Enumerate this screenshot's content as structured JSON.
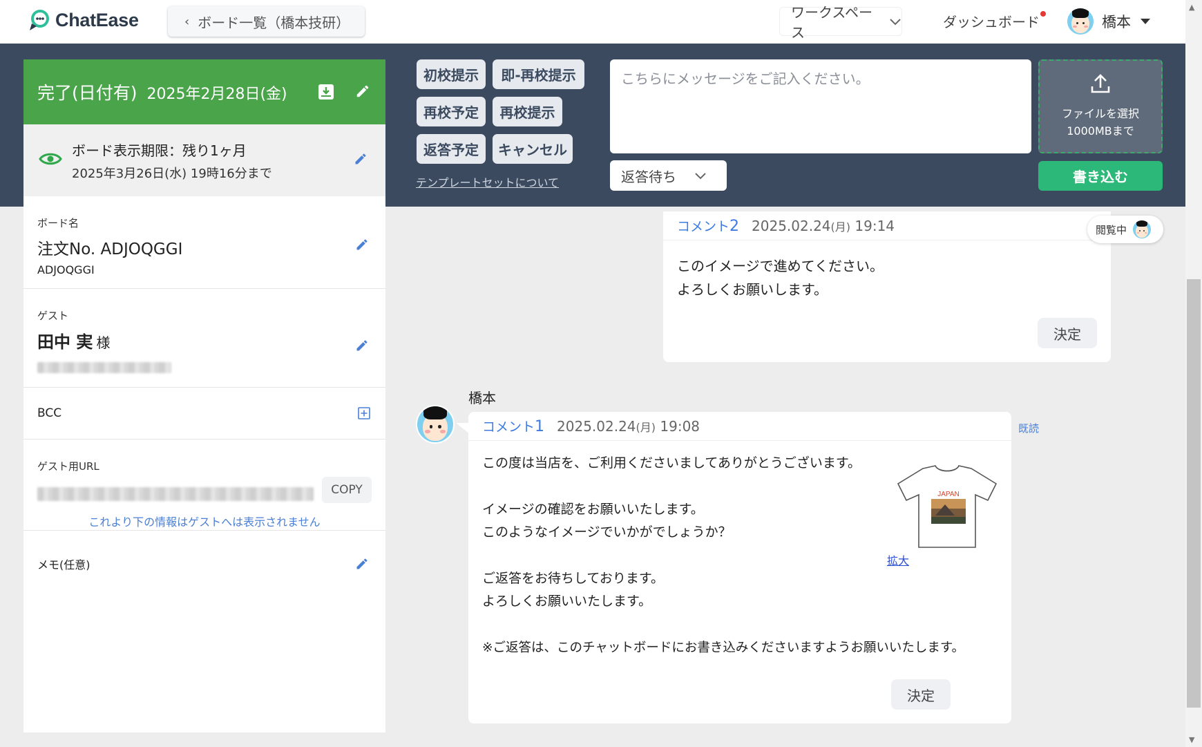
{
  "app": {
    "name": "ChatEase"
  },
  "header": {
    "back_label": "ボード一覧（橋本技研）",
    "workspace_label": "ワークスペース",
    "dashboard_label": "ダッシュボード",
    "user_name": "橋本"
  },
  "status": {
    "title": "完了(日付有)",
    "date": "2025年2月28日(金)"
  },
  "deadline": {
    "line1": "ボード表示期限：残り1ヶ月",
    "line2": "2025年3月26日(水) 19時16分まで"
  },
  "board": {
    "label": "ボード名",
    "title": "注文No. ADJOQGGI",
    "code": "ADJOQGGI"
  },
  "guest": {
    "label": "ゲスト",
    "name": "田中 実",
    "suffix": "様"
  },
  "bcc": {
    "label": "BCC"
  },
  "guest_url": {
    "label": "ゲスト用URL",
    "copy_label": "COPY"
  },
  "notice": "これより下の情報はゲストへは表示されません",
  "memo": {
    "label": "メモ(任意)"
  },
  "templates": {
    "buttons": [
      "初校提示",
      "即-再校提示",
      "再校予定",
      "再校提示",
      "返答予定",
      "キャンセル"
    ],
    "link": "テンプレートセットについて"
  },
  "composer": {
    "placeholder": "こちらにメッセージをご記入ください。",
    "status_value": "返答待ち",
    "file_line1": "ファイルを選択",
    "file_line2": "1000MBまで",
    "submit_label": "書き込む"
  },
  "viewing_label": "閲覧中",
  "comments": [
    {
      "label": "コメント",
      "number": "2",
      "datetime": "2025.02.24",
      "weekday": "(月)",
      "time": "19:14",
      "lines": [
        "このイメージで進めてください。",
        "よろしくお願いします。"
      ],
      "decide_label": "決定"
    },
    {
      "author": "橋本",
      "label": "コメント",
      "number": "1",
      "datetime": "2025.02.24",
      "weekday": "(月)",
      "time": "19:08",
      "read_label": "既読",
      "lines": [
        "この度は当店を、ご利用くださいましてありがとうございます。",
        "",
        "イメージの確認をお願いいたします。",
        "このようなイメージでいかがでしょうか？",
        "",
        "ご返答をお待ちしております。",
        "よろしくお願いいたします。",
        "",
        "※ご返答は、このチャットボードにお書き込みくださいますようお願いいたします。"
      ],
      "thumb_text": "JAPAN",
      "zoom_label": "拡大",
      "decide_label": "決定"
    }
  ],
  "colors": {
    "band": "#3b4a5f",
    "status_green": "#4aa44a",
    "submit_green": "#2cb878",
    "link_blue": "#3d7be0"
  }
}
